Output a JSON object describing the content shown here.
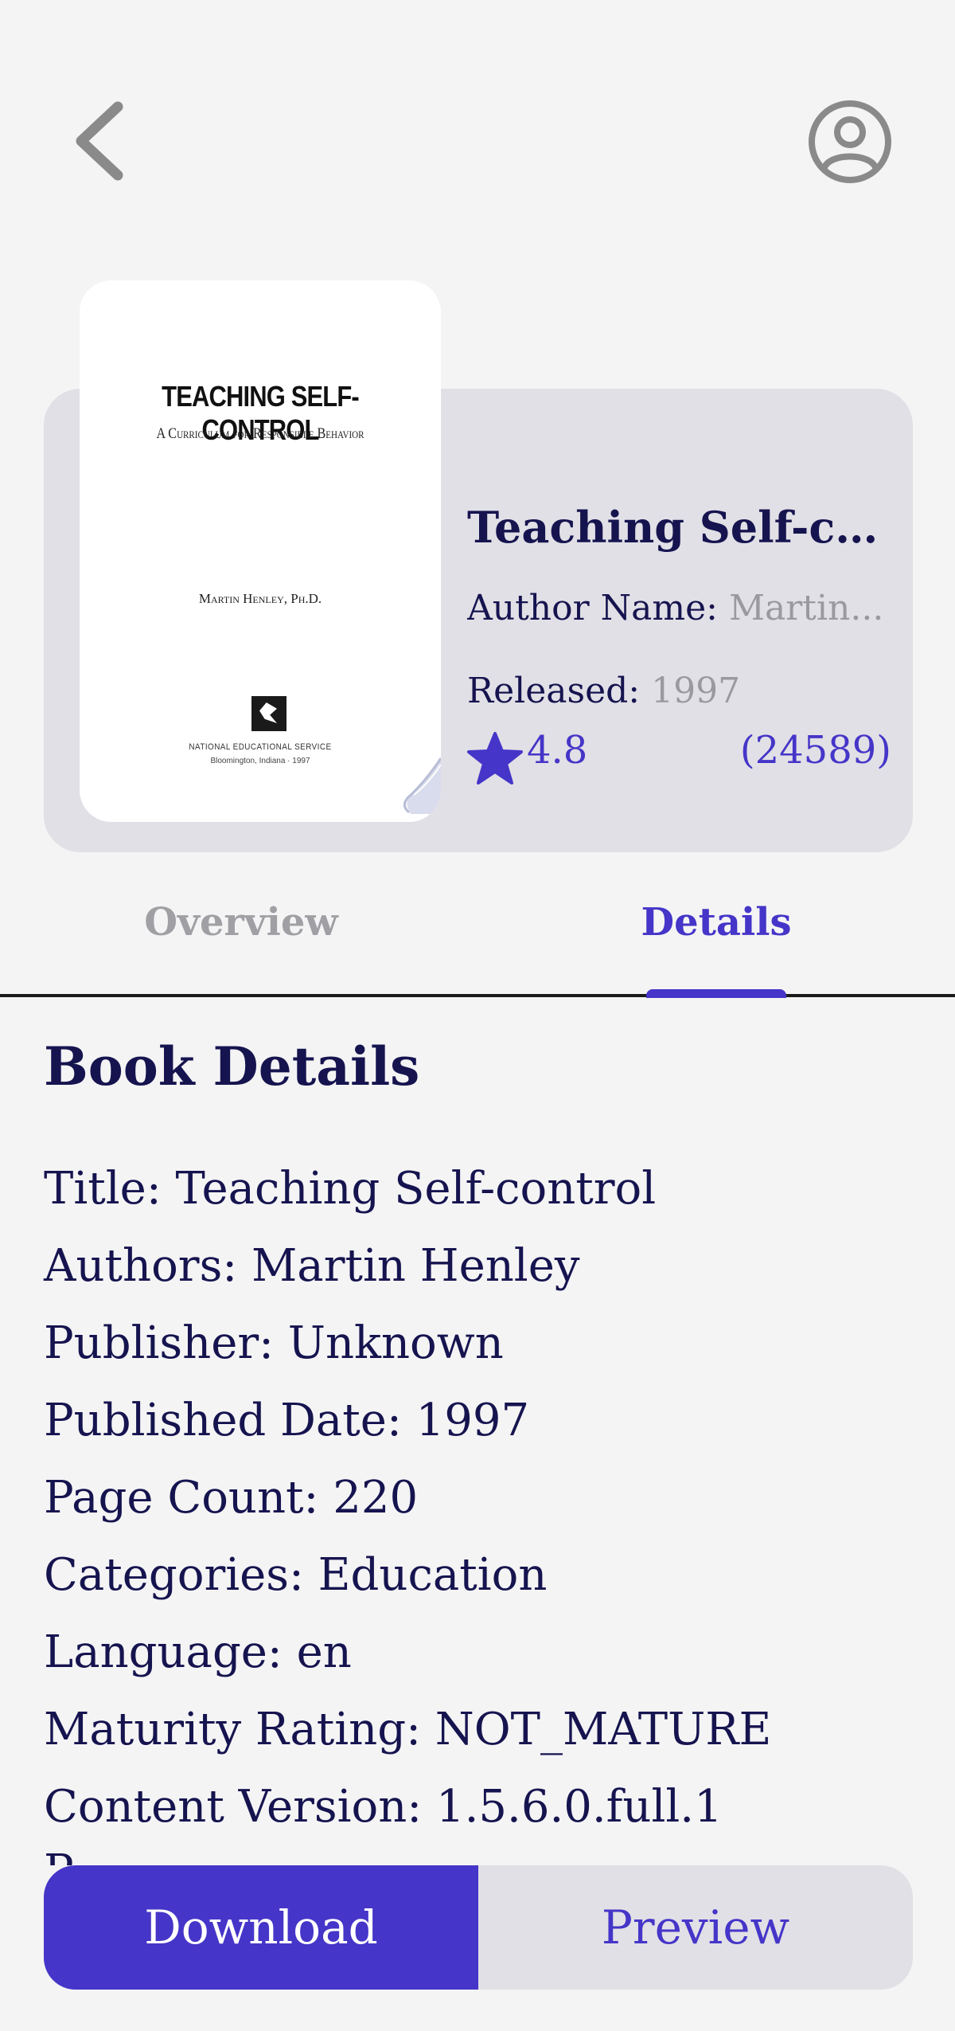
{
  "header": {
    "back_icon": "chevron-left-icon",
    "profile_icon": "user-circle-icon"
  },
  "book": {
    "cover": {
      "title": "TEACHING SELF-CONTROL",
      "subtitle": "A Curriculum for Responsible Behavior",
      "author": "Martin Henley, Ph.D.",
      "publisher": "NATIONAL EDUCATIONAL SERVICE",
      "place": "Bloomington, Indiana · 1997"
    },
    "title": "Teaching Self-co...",
    "author_label": "Author Name:",
    "author_value": "Martin...",
    "released_label": "Released:",
    "released_value": "1997",
    "rating": "4.8",
    "rating_count": "(24589)"
  },
  "tabs": [
    {
      "label": "Overview",
      "active": false
    },
    {
      "label": "Details",
      "active": true
    }
  ],
  "details": {
    "heading": "Book Details",
    "lines": [
      "Title: Teaching Self-control",
      "Authors: Martin Henley",
      "Publisher: Unknown",
      "Published Date: 1997",
      "Page Count: 220",
      "Categories: Education",
      "Language: en",
      "Maturity Rating: NOT_MATURE",
      "Content Version: 1.5.6.0.full.1"
    ],
    "partial_line": "P"
  },
  "actions": {
    "download_label": "Download",
    "preview_label": "Preview"
  },
  "colors": {
    "accent": "#4535c8",
    "text": "#16144f",
    "muted": "#9a9a9e",
    "card": "#e1e0e6",
    "background": "#f4f4f5"
  }
}
